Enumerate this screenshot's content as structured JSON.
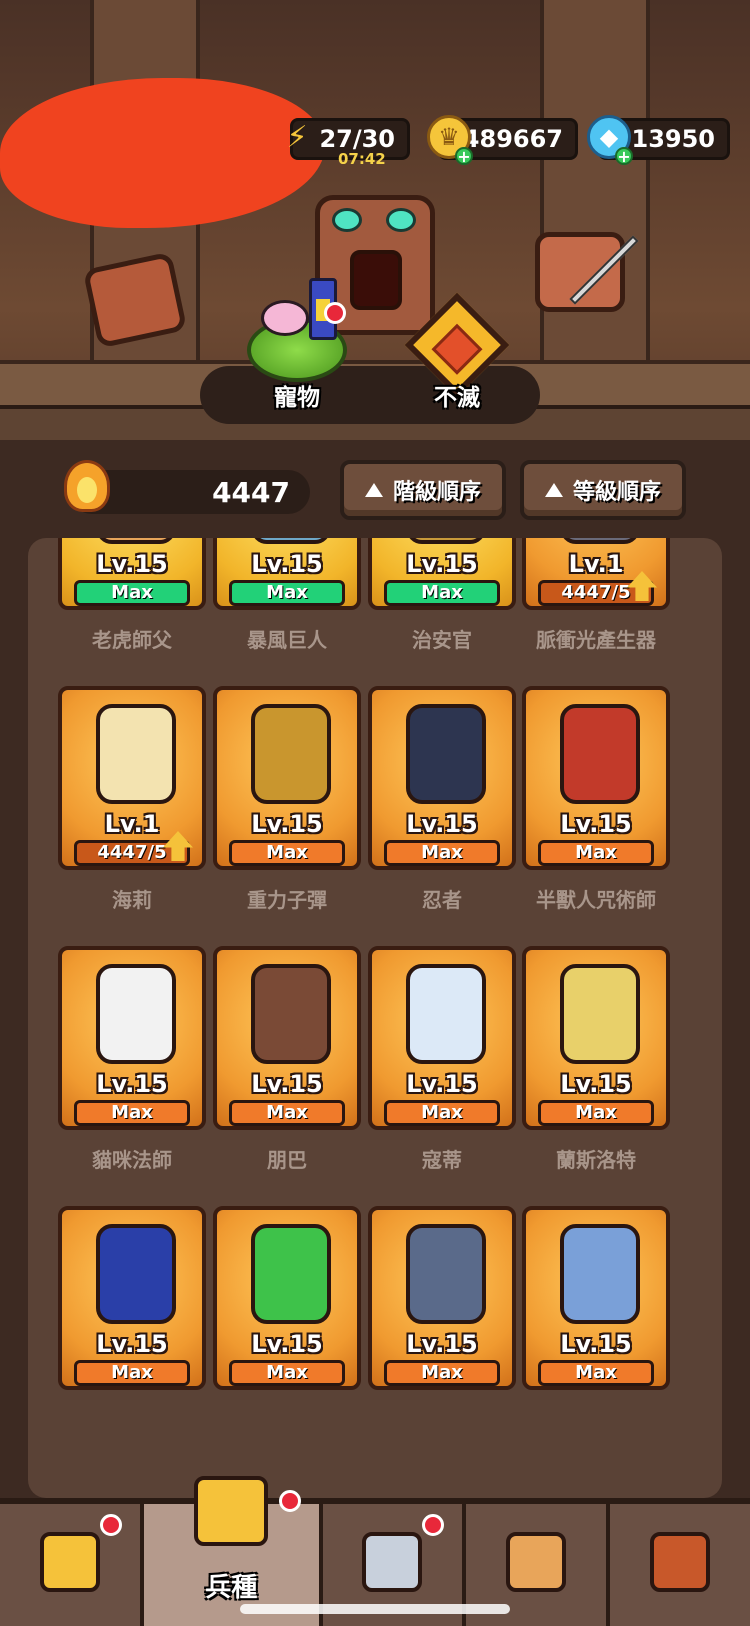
{
  "resources": {
    "energy": "27/30",
    "energy_timer": "07:42",
    "gold": "489667",
    "gems": "13950"
  },
  "modes": [
    {
      "label": "寵物",
      "icon": "pet-icon",
      "has_notification": true
    },
    {
      "label": "不滅",
      "icon": "immortal-gem-icon",
      "has_notification": false
    }
  ],
  "power": {
    "value": "4447",
    "icon": "flame-icon"
  },
  "sort": {
    "grade_label": "階級順序",
    "level_label": "等級順序"
  },
  "heroes": [
    {
      "name": "老虎師父",
      "level": "Lv.15",
      "status": "Max",
      "frame": "gold",
      "color": "#e8a55a"
    },
    {
      "name": "暴風巨人",
      "level": "Lv.15",
      "status": "Max",
      "frame": "gold",
      "color": "#6fa8c8"
    },
    {
      "name": "治安官",
      "level": "Lv.15",
      "status": "Max",
      "frame": "gold",
      "color": "#c99a3a"
    },
    {
      "name": "脈衝光產生器",
      "level": "Lv.1",
      "status": "4447/5",
      "frame": "orange",
      "color": "#6a6a7a",
      "upgrade": true
    },
    {
      "name": "海莉",
      "level": "Lv.1",
      "status": "4447/5",
      "frame": "orange",
      "color": "#f3e3b0",
      "upgrade": true
    },
    {
      "name": "重力子彈",
      "level": "Lv.15",
      "status": "Max",
      "frame": "orange",
      "color": "#c9962e"
    },
    {
      "name": "忍者",
      "level": "Lv.15",
      "status": "Max",
      "frame": "orange",
      "color": "#2d3550"
    },
    {
      "name": "半獸人咒術師",
      "level": "Lv.15",
      "status": "Max",
      "frame": "orange",
      "color": "#c23a2a"
    },
    {
      "name": "貓咪法師",
      "level": "Lv.15",
      "status": "Max",
      "frame": "orange",
      "color": "#f2f2f2"
    },
    {
      "name": "朋巴",
      "level": "Lv.15",
      "status": "Max",
      "frame": "orange",
      "color": "#7a4a36"
    },
    {
      "name": "寇蒂",
      "level": "Lv.15",
      "status": "Max",
      "frame": "orange",
      "color": "#dce9f7"
    },
    {
      "name": "蘭斯洛特",
      "level": "Lv.15",
      "status": "Max",
      "frame": "orange",
      "color": "#e8d06a"
    },
    {
      "name": "",
      "level": "Lv.15",
      "status": "Max",
      "frame": "orange",
      "color": "#2a3fa8"
    },
    {
      "name": "",
      "level": "Lv.15",
      "status": "Max",
      "frame": "orange",
      "color": "#3ec24a"
    },
    {
      "name": "",
      "level": "Lv.15",
      "status": "Max",
      "frame": "orange",
      "color": "#5a6a8a"
    },
    {
      "name": "",
      "level": "Lv.15",
      "status": "Max",
      "frame": "orange",
      "color": "#7aa0d8"
    }
  ],
  "nav": [
    {
      "label": "",
      "icon": "shop-icon",
      "color": "#f5c23a",
      "has_notification": true,
      "active": false
    },
    {
      "label": "兵種",
      "icon": "crown-icon",
      "color": "#f5c23a",
      "has_notification": true,
      "active": true
    },
    {
      "label": "",
      "icon": "crossed-swords-icon",
      "color": "#c8d0dc",
      "has_notification": true,
      "active": false
    },
    {
      "label": "",
      "icon": "card-icon",
      "color": "#e8a55a",
      "has_notification": false,
      "active": false
    },
    {
      "label": "",
      "icon": "treasure-icon",
      "color": "#c8582a",
      "has_notification": false,
      "active": false
    }
  ]
}
